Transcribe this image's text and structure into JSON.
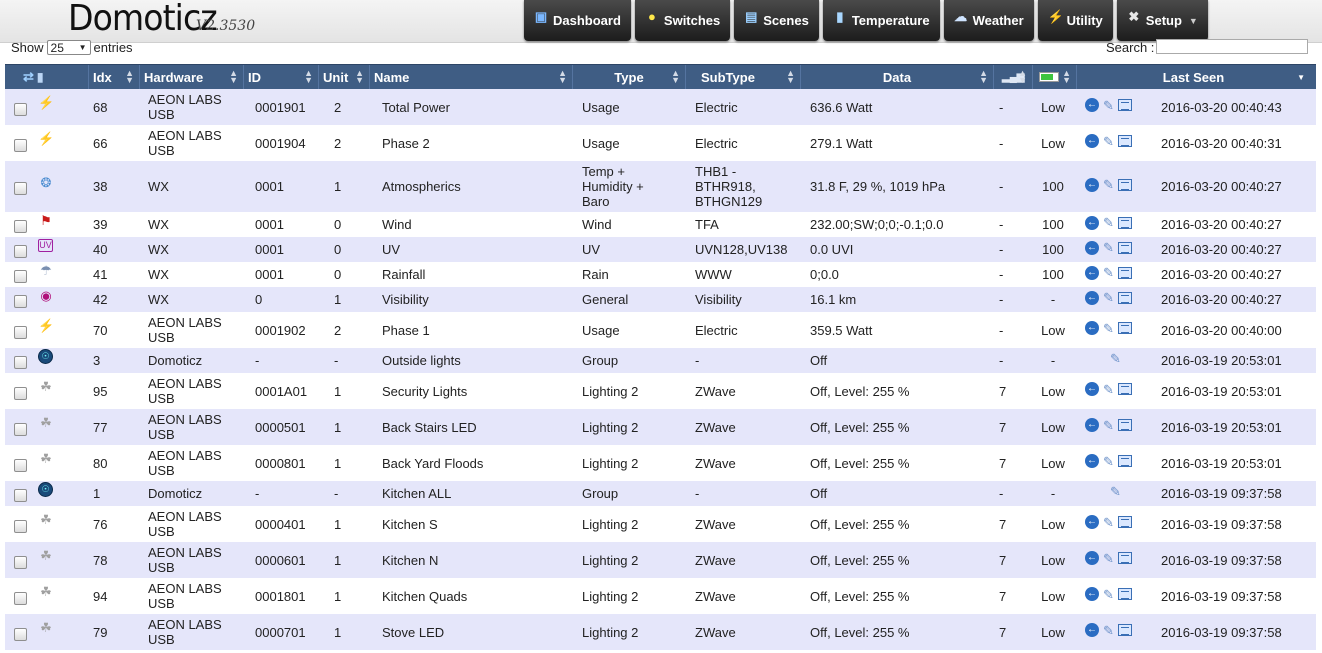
{
  "brand": {
    "name": "Domoticz",
    "version": "V2.3530"
  },
  "nav": [
    {
      "label": "Dashboard",
      "icon": "dashboard-icon"
    },
    {
      "label": "Switches",
      "icon": "lightbulb-icon"
    },
    {
      "label": "Scenes",
      "icon": "scene-icon"
    },
    {
      "label": "Temperature",
      "icon": "thermometer-icon"
    },
    {
      "label": "Weather",
      "icon": "cloud-icon"
    },
    {
      "label": "Utility",
      "icon": "utility-icon"
    },
    {
      "label": "Setup",
      "icon": "tools-icon",
      "dropdown": true
    }
  ],
  "controls": {
    "show_label": "Show",
    "page_size": "25",
    "entries_label": "entries",
    "search_label": "Search :",
    "search_value": ""
  },
  "columns": [
    "",
    "Idx",
    "Hardware",
    "ID",
    "Unit",
    "Name",
    "Type",
    "SubType",
    "Data",
    "",
    "",
    "",
    "Last Seen"
  ],
  "rows": [
    {
      "icon": "usage",
      "idx": "68",
      "hardware": [
        "AEON LABS",
        "USB"
      ],
      "id": "0001901",
      "unit": "2",
      "name": "Total Power",
      "type": [
        "Usage"
      ],
      "subtype": [
        "Electric"
      ],
      "data": "636.6 Watt",
      "signal": "-",
      "battery": "Low",
      "actions": [
        "log",
        "edit",
        "notify"
      ],
      "last_seen": "2016-03-20 00:40:43"
    },
    {
      "icon": "usage",
      "idx": "66",
      "hardware": [
        "AEON LABS",
        "USB"
      ],
      "id": "0001904",
      "unit": "2",
      "name": "Phase 2",
      "type": [
        "Usage"
      ],
      "subtype": [
        "Electric"
      ],
      "data": "279.1 Watt",
      "signal": "-",
      "battery": "Low",
      "actions": [
        "log",
        "edit",
        "notify"
      ],
      "last_seen": "2016-03-20 00:40:31"
    },
    {
      "icon": "thermo",
      "idx": "38",
      "hardware": [
        "WX"
      ],
      "id": "0001",
      "unit": "1",
      "name": "Atmospherics",
      "type": [
        "Temp +",
        "Humidity +",
        "Baro"
      ],
      "subtype": [
        "THB1 -",
        "BTHR918,",
        "BTHGN129"
      ],
      "data": "31.8 F, 29 %, 1019 hPa",
      "signal": "-",
      "battery": "100",
      "actions": [
        "log",
        "edit",
        "notify"
      ],
      "last_seen": "2016-03-20 00:40:27"
    },
    {
      "icon": "wind",
      "idx": "39",
      "hardware": [
        "WX"
      ],
      "id": "0001",
      "unit": "0",
      "name": "Wind",
      "type": [
        "Wind"
      ],
      "subtype": [
        "TFA"
      ],
      "data": "232.00;SW;0;0;-0.1;0.0",
      "signal": "-",
      "battery": "100",
      "actions": [
        "log",
        "edit",
        "notify"
      ],
      "last_seen": "2016-03-20 00:40:27"
    },
    {
      "icon": "uv",
      "idx": "40",
      "hardware": [
        "WX"
      ],
      "id": "0001",
      "unit": "0",
      "name": "UV",
      "type": [
        "UV"
      ],
      "subtype": [
        "UVN128,UV138"
      ],
      "data": "0.0 UVI",
      "signal": "-",
      "battery": "100",
      "actions": [
        "log",
        "edit",
        "notify"
      ],
      "last_seen": "2016-03-20 00:40:27"
    },
    {
      "icon": "rain",
      "idx": "41",
      "hardware": [
        "WX"
      ],
      "id": "0001",
      "unit": "0",
      "name": "Rainfall",
      "type": [
        "Rain"
      ],
      "subtype": [
        "WWW"
      ],
      "data": "0;0.0",
      "signal": "-",
      "battery": "100",
      "actions": [
        "log",
        "edit",
        "notify"
      ],
      "last_seen": "2016-03-20 00:40:27"
    },
    {
      "icon": "vis",
      "idx": "42",
      "hardware": [
        "WX"
      ],
      "id": "0",
      "unit": "1",
      "name": "Visibility",
      "type": [
        "General"
      ],
      "subtype": [
        "Visibility"
      ],
      "data": "16.1 km",
      "signal": "-",
      "battery": "-",
      "actions": [
        "log",
        "edit",
        "notify"
      ],
      "last_seen": "2016-03-20 00:40:27"
    },
    {
      "icon": "usage",
      "idx": "70",
      "hardware": [
        "AEON LABS",
        "USB"
      ],
      "id": "0001902",
      "unit": "2",
      "name": "Phase 1",
      "type": [
        "Usage"
      ],
      "subtype": [
        "Electric"
      ],
      "data": "359.5 Watt",
      "signal": "-",
      "battery": "Low",
      "actions": [
        "log",
        "edit",
        "notify"
      ],
      "last_seen": "2016-03-20 00:40:00"
    },
    {
      "icon": "group",
      "idx": "3",
      "hardware": [
        "Domoticz"
      ],
      "id": "-",
      "unit": "-",
      "name": "Outside lights",
      "type": [
        "Group"
      ],
      "subtype": [
        "-"
      ],
      "data": "Off",
      "signal": "-",
      "battery": "-",
      "actions": [
        "edit"
      ],
      "last_seen": "2016-03-19 20:53:01"
    },
    {
      "icon": "light",
      "idx": "95",
      "hardware": [
        "AEON LABS",
        "USB"
      ],
      "id": "0001A01",
      "unit": "1",
      "name": "Security Lights",
      "type": [
        "Lighting 2"
      ],
      "subtype": [
        "ZWave"
      ],
      "data": "Off, Level: 255 %",
      "signal": "7",
      "battery": "Low",
      "actions": [
        "log",
        "edit",
        "notify"
      ],
      "last_seen": "2016-03-19 20:53:01"
    },
    {
      "icon": "light",
      "idx": "77",
      "hardware": [
        "AEON LABS",
        "USB"
      ],
      "id": "0000501",
      "unit": "1",
      "name": "Back Stairs LED",
      "type": [
        "Lighting 2"
      ],
      "subtype": [
        "ZWave"
      ],
      "data": "Off, Level: 255 %",
      "signal": "7",
      "battery": "Low",
      "actions": [
        "log",
        "edit",
        "notify"
      ],
      "last_seen": "2016-03-19 20:53:01"
    },
    {
      "icon": "light",
      "idx": "80",
      "hardware": [
        "AEON LABS",
        "USB"
      ],
      "id": "0000801",
      "unit": "1",
      "name": "Back Yard Floods",
      "type": [
        "Lighting 2"
      ],
      "subtype": [
        "ZWave"
      ],
      "data": "Off, Level: 255 %",
      "signal": "7",
      "battery": "Low",
      "actions": [
        "log",
        "edit",
        "notify"
      ],
      "last_seen": "2016-03-19 20:53:01"
    },
    {
      "icon": "group",
      "idx": "1",
      "hardware": [
        "Domoticz"
      ],
      "id": "-",
      "unit": "-",
      "name": "Kitchen ALL",
      "type": [
        "Group"
      ],
      "subtype": [
        "-"
      ],
      "data": "Off",
      "signal": "-",
      "battery": "-",
      "actions": [
        "edit"
      ],
      "last_seen": "2016-03-19 09:37:58"
    },
    {
      "icon": "light",
      "idx": "76",
      "hardware": [
        "AEON LABS",
        "USB"
      ],
      "id": "0000401",
      "unit": "1",
      "name": "Kitchen S",
      "type": [
        "Lighting 2"
      ],
      "subtype": [
        "ZWave"
      ],
      "data": "Off, Level: 255 %",
      "signal": "7",
      "battery": "Low",
      "actions": [
        "log",
        "edit",
        "notify"
      ],
      "last_seen": "2016-03-19 09:37:58"
    },
    {
      "icon": "light",
      "idx": "78",
      "hardware": [
        "AEON LABS",
        "USB"
      ],
      "id": "0000601",
      "unit": "1",
      "name": "Kitchen N",
      "type": [
        "Lighting 2"
      ],
      "subtype": [
        "ZWave"
      ],
      "data": "Off, Level: 255 %",
      "signal": "7",
      "battery": "Low",
      "actions": [
        "log",
        "edit",
        "notify"
      ],
      "last_seen": "2016-03-19 09:37:58"
    },
    {
      "icon": "light",
      "idx": "94",
      "hardware": [
        "AEON LABS",
        "USB"
      ],
      "id": "0001801",
      "unit": "1",
      "name": "Kitchen Quads",
      "type": [
        "Lighting 2"
      ],
      "subtype": [
        "ZWave"
      ],
      "data": "Off, Level: 255 %",
      "signal": "7",
      "battery": "Low",
      "actions": [
        "log",
        "edit",
        "notify"
      ],
      "last_seen": "2016-03-19 09:37:58"
    },
    {
      "icon": "light",
      "idx": "79",
      "hardware": [
        "AEON LABS",
        "USB"
      ],
      "id": "0000701",
      "unit": "1",
      "name": "Stove LED",
      "type": [
        "Lighting 2"
      ],
      "subtype": [
        "ZWave"
      ],
      "data": "Off, Level: 255 %",
      "signal": "7",
      "battery": "Low",
      "actions": [
        "log",
        "edit",
        "notify"
      ],
      "last_seen": "2016-03-19 09:37:58"
    }
  ]
}
